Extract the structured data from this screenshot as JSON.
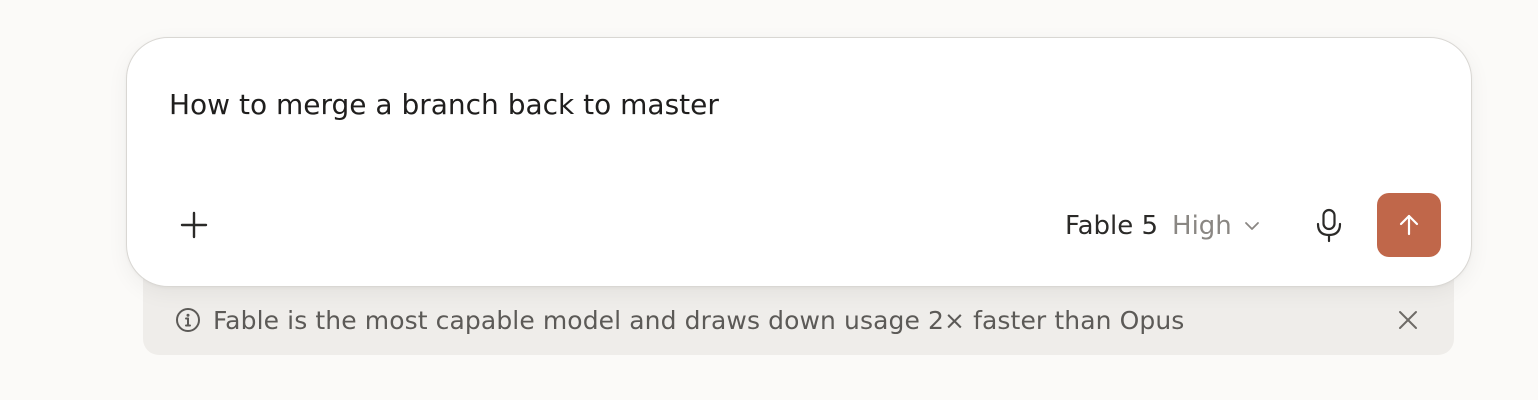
{
  "composer": {
    "input_value": "How to merge a branch back to master",
    "model_name": "Fable 5",
    "effort_level": "High"
  },
  "info_banner": {
    "message": "Fable is the most capable model and draws down usage 2× faster than Opus"
  },
  "icons": {
    "add": "plus-icon",
    "chevron": "chevron-down-icon",
    "mic": "microphone-icon",
    "send": "arrow-up-icon",
    "info": "info-circle-icon",
    "close": "close-icon"
  },
  "colors": {
    "send_button": "#c0674a",
    "background": "#fbfaf8",
    "banner": "#efedea"
  }
}
